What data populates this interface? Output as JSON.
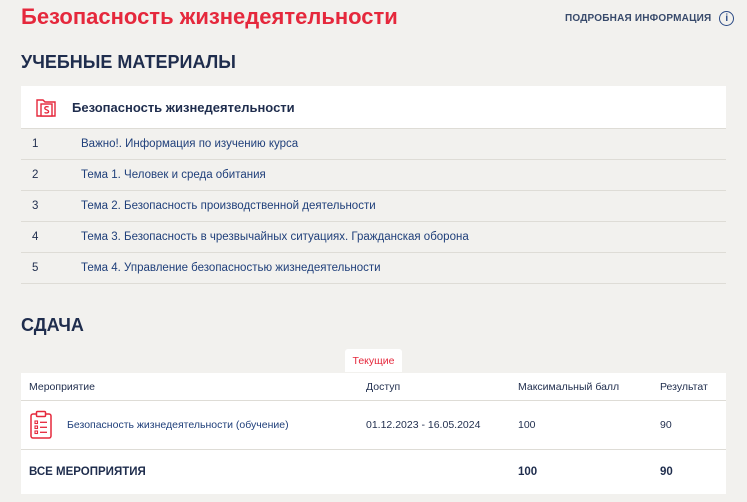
{
  "header": {
    "title": "Безопасность жизнедеятельности",
    "info_link": "ПОДРОБНАЯ ИНФОРМАЦИЯ",
    "info_icon": "i"
  },
  "materials": {
    "section_title": "УЧЕБНЫЕ МАТЕРИАЛЫ",
    "course_icon": "document-s-icon",
    "course_title": "Безопасность жизнедеятельности",
    "items": [
      {
        "num": "1",
        "label": "Важно!. Информация по изучению курса"
      },
      {
        "num": "2",
        "label": "Тема 1. Человек и среда обитания"
      },
      {
        "num": "3",
        "label": "Тема 2. Безопасность производственной деятельности"
      },
      {
        "num": "4",
        "label": "Тема 3. Безопасность в чрезвычайных ситуациях. Гражданская оборона"
      },
      {
        "num": "5",
        "label": "Тема 4. Управление безопасностью жизнедеятельности"
      }
    ]
  },
  "submission": {
    "section_title": "СДАЧА",
    "tab_label": "Текущие",
    "columns": [
      "Мероприятие",
      "Доступ",
      "Максимальный балл",
      "Результат"
    ],
    "rows": [
      {
        "icon": "clipboard-icon",
        "name": "Безопасность жизнедеятельности (обучение)",
        "access": "01.12.2023 - 16.05.2024",
        "max": "100",
        "result": "90"
      }
    ],
    "total": {
      "label": "ВСЕ МЕРОПРИЯТИЯ",
      "max": "100",
      "result": "90"
    }
  },
  "colors": {
    "accent": "#e5283c",
    "text": "#1f2d4d",
    "link": "#1f3f7a",
    "background": "#f2f1ee"
  }
}
